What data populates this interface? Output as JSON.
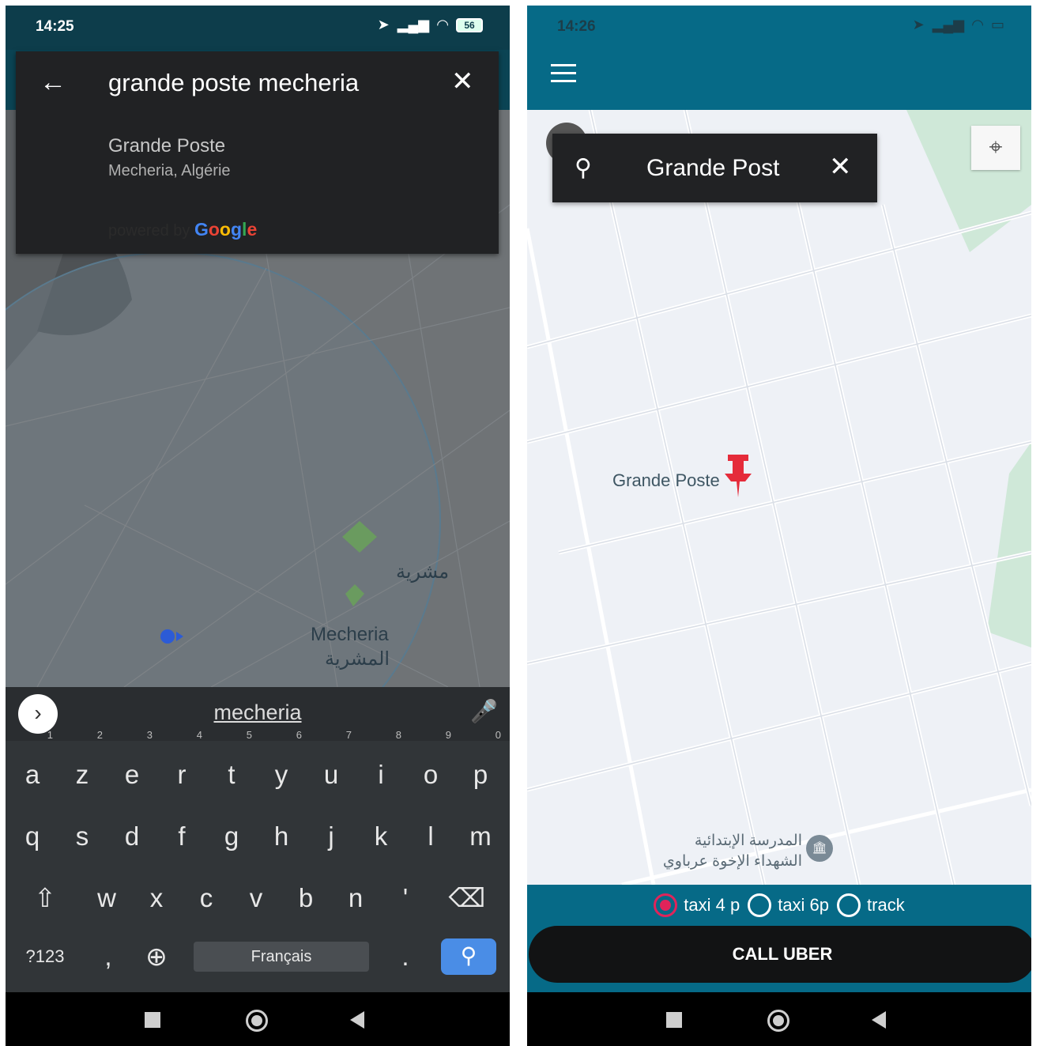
{
  "left_screen": {
    "status": {
      "time": "14:25",
      "battery": "56"
    },
    "search": {
      "query": "grande poste mecheria",
      "result_title": "Grande Poste",
      "result_subtitle": "Mecheria, Algérie",
      "powered_prefix": "powered by ",
      "powered_brand": "Google"
    },
    "map": {
      "label_arabic_1": "مشرية",
      "label_latin": "Mecheria",
      "label_arabic_2": "المشرية"
    },
    "keyboard": {
      "suggestion": "mecheria",
      "row1": [
        {
          "k": "a",
          "n": "1"
        },
        {
          "k": "z",
          "n": "2"
        },
        {
          "k": "e",
          "n": "3"
        },
        {
          "k": "r",
          "n": "4"
        },
        {
          "k": "t",
          "n": "5"
        },
        {
          "k": "y",
          "n": "6"
        },
        {
          "k": "u",
          "n": "7"
        },
        {
          "k": "i",
          "n": "8"
        },
        {
          "k": "o",
          "n": "9"
        },
        {
          "k": "p",
          "n": "0"
        }
      ],
      "row2": [
        "q",
        "s",
        "d",
        "f",
        "g",
        "h",
        "j",
        "k",
        "l",
        "m"
      ],
      "row3": [
        "w",
        "x",
        "c",
        "v",
        "b",
        "n",
        "'"
      ],
      "symbols_key": "?123",
      "comma_key": ",",
      "space_label": "Français",
      "period_key": "."
    }
  },
  "right_screen": {
    "status": {
      "time": "14:26"
    },
    "search": {
      "text": "Grande Post"
    },
    "map": {
      "place_label": "Grande Poste",
      "school_line1": "المدرسة الإبتدائية",
      "school_line2": "الشهداء الإخوة عرباوي"
    },
    "vehicle_options": [
      {
        "label": "taxi 4 p",
        "selected": true
      },
      {
        "label": "taxi 6p",
        "selected": false
      },
      {
        "label": "track",
        "selected": false
      }
    ],
    "call_button": "CALL UBER"
  },
  "colors": {
    "app_bar": "#066a87",
    "dark_panel": "#212224",
    "pin": "#e52b3a",
    "radio_selected": "#e0245a",
    "keyboard_bg": "#313538",
    "search_key": "#4a8de6"
  }
}
